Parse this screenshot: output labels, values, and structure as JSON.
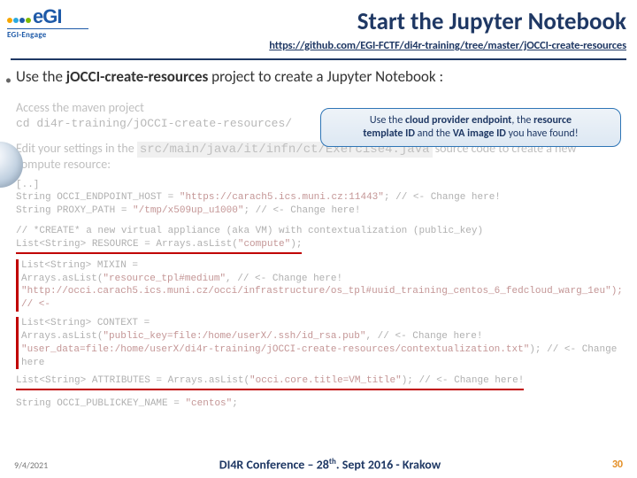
{
  "logo": {
    "brand": "eGI",
    "sub": "EGI-Engage"
  },
  "title": "Start the Jupyter Notebook",
  "url": "https://github.com/EGI-FCTF/di4r-training/tree/master/jOCCI-create-resources",
  "bullet": {
    "pre": "Use the ",
    "bold": "jOCCI-create-resources",
    "post": " project to create a Jupyter Notebook :"
  },
  "callout": {
    "l1a": "Use the ",
    "l1b": "cloud provider endpoint",
    "l1c": ", the ",
    "l1d": "resource",
    "l2a": "template ID",
    "l2b": " and the ",
    "l2c": "VA image ID",
    "l2d": " you have found!"
  },
  "section1": "Access the maven project",
  "cmd1": "cd di4r-training/jOCCI-create-resources/",
  "section2_a": "Edit your settings in the ",
  "section2_code": "src/main/java/it/infn/ct/Exercise4.java",
  "section2_b": " source code to create a new compute resource:",
  "code": {
    "l0": "[..]",
    "l1a": "String OCCI_ENDPOINT_HOST = ",
    "l1b": "\"https://carach5.ics.muni.cz:11443\"",
    "l1c": "; // <- Change here!",
    "l2a": "String PROXY_PATH = ",
    "l2b": "\"/tmp/x509up_u1000\"",
    "l2c": "; // <- Change here!",
    "l3": "// *CREATE* a new virtual appliance (aka VM) with contextualization (public_key)",
    "l4a": "List<String> RESOURCE = Arrays.asList(",
    "l4b": "\"compute\"",
    "l4c": ");",
    "l5": "List<String> MIXIN =",
    "l6a": "Arrays.asList(",
    "l6b": "\"resource_tpl#medium\"",
    "l6c": ", // <- Change here!",
    "l7": "\"http://occi.carach5.ics.muni.cz/occi/infrastructure/os_tpl#uuid_training_centos_6_fedcloud_warg_1eu\"); // <-",
    "l8": "List<String> CONTEXT =",
    "l9a": "Arrays.asList(",
    "l9b": "\"public_key=file:/home/userX/.ssh/id_rsa.pub\"",
    "l9c": ", // <- Change here!",
    "l10a": "",
    "l10b": "\"user_data=file:/home/userX/di4r-training/jOCCI-create-resources/contextualization.txt\"",
    "l10c": "); // <- Change here",
    "l11a": "List<String> ATTRIBUTES = Arrays.asList(",
    "l11b": "\"occi.core.title=VM_title\"",
    "l11c": "); // <- Change here!",
    "l12a": "String OCCI_PUBLICKEY_NAME = ",
    "l12b": "\"centos\"",
    "l12c": ";"
  },
  "footer": {
    "date": "9/4/2021",
    "mid_a": "DI4R Conference – 28",
    "mid_sup": "th",
    "mid_b": ". Sept 2016 - Krakow",
    "page": "30"
  }
}
